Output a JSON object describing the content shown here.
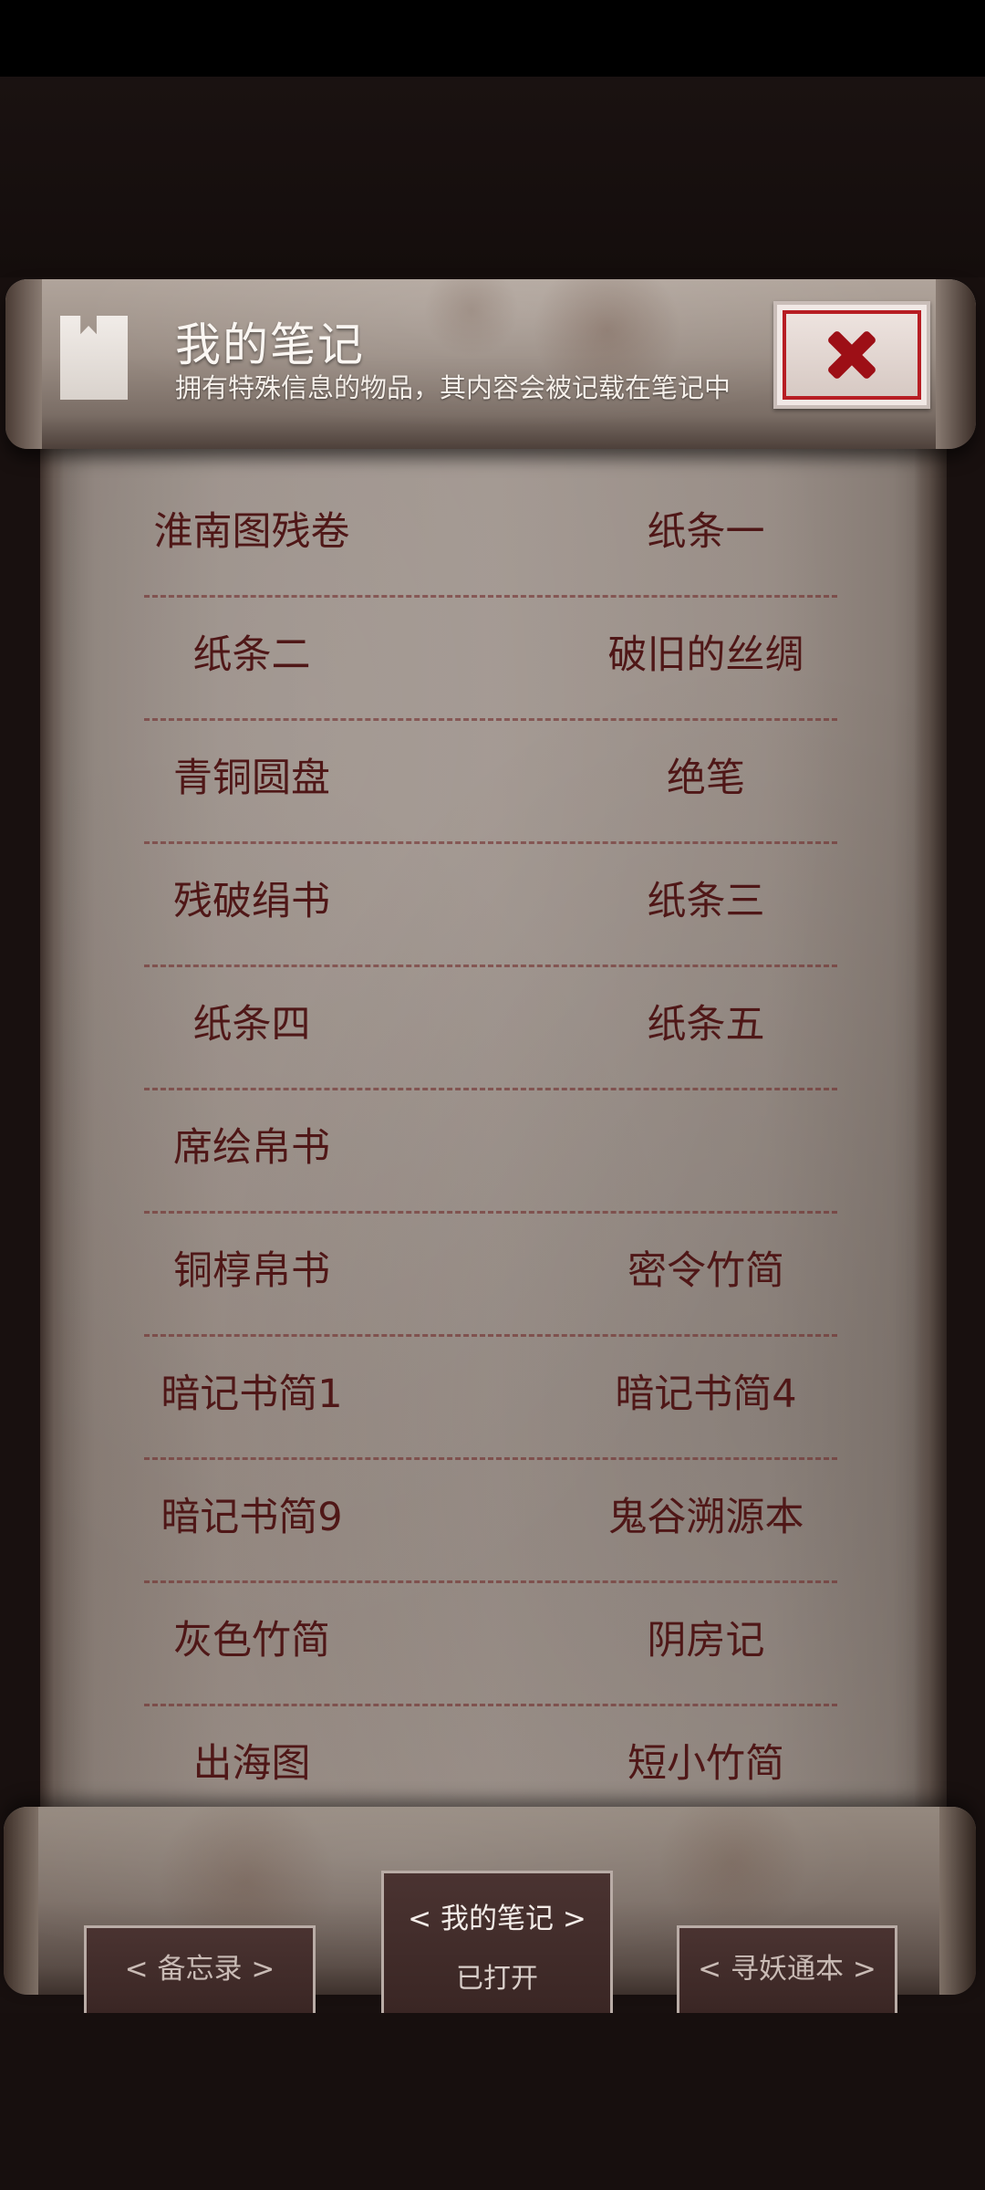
{
  "header": {
    "title": "我的笔记",
    "subtitle": "拥有特殊信息的物品，其内容会被记载在笔记中"
  },
  "notes": [
    [
      "淮南图残卷",
      "纸条一"
    ],
    [
      "纸条二",
      "破旧的丝绸"
    ],
    [
      "青铜圆盘",
      "绝笔"
    ],
    [
      "残破绢书",
      "纸条三"
    ],
    [
      "纸条四",
      "纸条五"
    ],
    [
      "席绘帛书",
      ""
    ],
    [
      "铜椁帛书",
      "密令竹简"
    ],
    [
      "暗记书简1",
      "暗记书简4"
    ],
    [
      "暗记书简9",
      "鬼谷溯源本"
    ],
    [
      "灰色竹简",
      "阴房记"
    ],
    [
      "出海图",
      "短小竹简"
    ]
  ],
  "tabs": {
    "left": "< 备忘录 >",
    "center_label": "< 我的笔记 >",
    "center_status": "已打开",
    "right": "< 寻妖通本 >"
  },
  "icons": {
    "header": "notebook-icon",
    "close": "close-icon"
  },
  "colors": {
    "note_text": "#4f1717",
    "close_accent": "#9d0f16"
  }
}
